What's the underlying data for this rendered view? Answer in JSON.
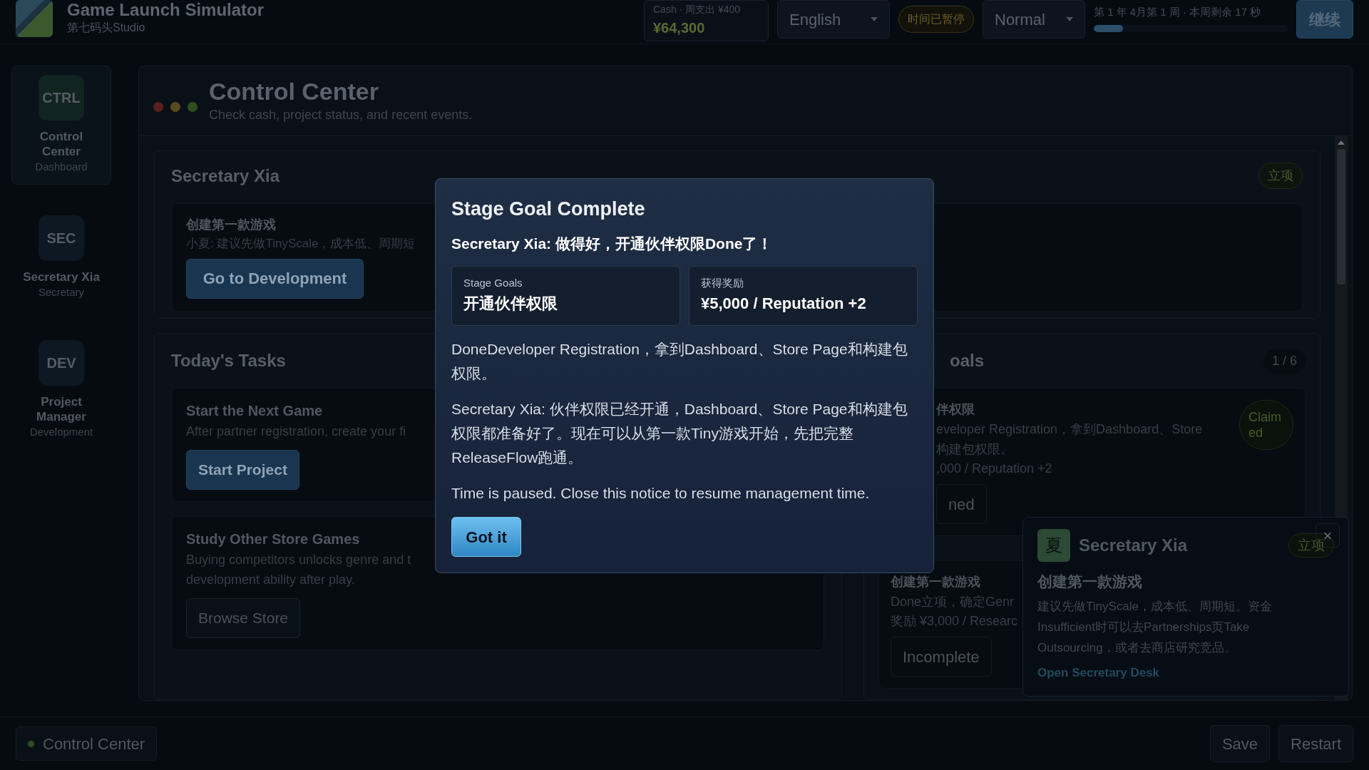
{
  "app": {
    "title": "Game Launch Simulator",
    "studio": "第七码头Studio"
  },
  "topbar": {
    "cash_label": "Cash · 周支出 ¥400",
    "cash": "¥64,300",
    "language": "English",
    "paused_badge": "时间已暂停",
    "speed": "Normal",
    "week": "第 1 年 4月第 1 周 · 本周剩余 17 秒",
    "week_progress": {
      "level": 0.15
    },
    "resume_button": "继续"
  },
  "sidebar": [
    {
      "code": "CTRL",
      "label": "Control Center",
      "sub": "Dashboard",
      "selected": true
    },
    {
      "code": "SEC",
      "label": "Secretary Xia",
      "sub": "Secretary",
      "selected": false
    },
    {
      "code": "DEV",
      "label": "Project Manager",
      "sub": "Development",
      "selected": false
    }
  ],
  "page": {
    "title": "Control Center",
    "subtitle": "Check cash, project status, and recent events."
  },
  "secretary_card": {
    "title": "Secretary Xia",
    "badge": "立项",
    "task_title": "创建第一款游戏",
    "task_text": "小夏: 建议先做TinyScale，成本低、周期短",
    "button": "Go to Development"
  },
  "tasks": {
    "title": "Today's Tasks",
    "items": [
      {
        "title": "Start the Next Game",
        "lines": [
          "After partner registration, create your fi"
        ],
        "button": "Start Project",
        "kind": "primary"
      },
      {
        "title": "Study Other Store Games",
        "lines": [
          "Buying competitors unlocks genre and t",
          "development ability after play."
        ],
        "button": "Browse Store",
        "kind": "secondary"
      }
    ]
  },
  "goals": {
    "title": "oals",
    "count": "1 / 6",
    "items": [
      {
        "title": "伴权限",
        "lines": [
          "eveloper Registration，拿到Dashboard、Store",
          "构建包权限。"
        ],
        "reward": ",000 / Reputation +2",
        "button": "ned",
        "status": "Claimed"
      },
      {
        "title": "创建第一款游戏",
        "lines": [
          "Done立项，确定Genr"
        ],
        "reward": "奖励 ¥3,000 / Researc",
        "button": "Incomplete"
      }
    ]
  },
  "modal": {
    "title": "Stage Goal Complete",
    "message": "Secretary Xia: 做得好，开通伙伴权限Done了！",
    "stats": [
      {
        "label": "Stage Goals",
        "value": "开通伙伴权限"
      },
      {
        "label": "获得奖励",
        "value": "¥5,000 / Reputation +2"
      }
    ],
    "paragraphs": [
      "DoneDeveloper Registration，拿到Dashboard、Store Page和构建包权限。",
      "Secretary Xia: 伙伴权限已经开通，Dashboard、Store Page和构建包权限都准备好了。现在可以从第一款Tiny游戏开始，先把完整ReleaseFlow跑通。",
      "Time is paused. Close this notice to resume management time."
    ],
    "button": "Got it"
  },
  "toast": {
    "avatar": "夏",
    "title": "Secretary Xia",
    "badge": "立项",
    "close": "×",
    "task_title": "创建第一款游戏",
    "text": "建议先做TinyScale，成本低、周期短。资金Insufficient时可以去Partnerships页Take Outsourcing，或者去商店研究竞品。",
    "link": "Open Secretary Desk"
  },
  "bottom": {
    "status": "Control Center",
    "buttons": [
      "Save",
      "Restart"
    ]
  }
}
